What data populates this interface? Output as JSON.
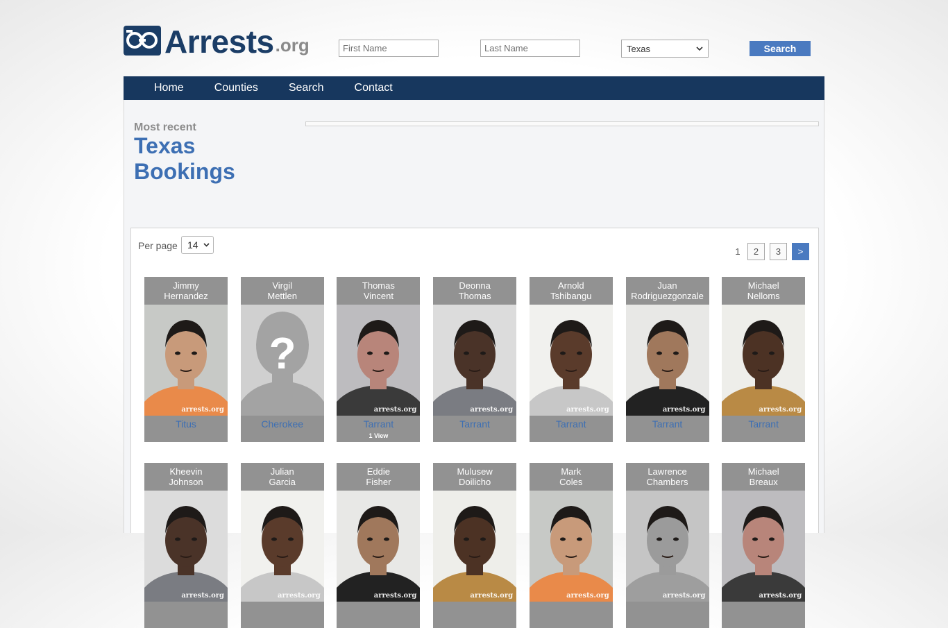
{
  "header": {
    "logo_word": "Arrests",
    "logo_ext": ".org",
    "first_name_placeholder": "First Name",
    "last_name_placeholder": "Last Name",
    "state_selected": "Texas",
    "search_label": "Search"
  },
  "nav": {
    "items": [
      {
        "label": "Home"
      },
      {
        "label": "Counties"
      },
      {
        "label": "Search"
      },
      {
        "label": "Contact"
      }
    ]
  },
  "main": {
    "subtitle": "Most recent",
    "title_line1": "Texas",
    "title_line2": "Bookings"
  },
  "listing": {
    "per_page_label": "Per page",
    "per_page_value": "14",
    "pagination": [
      "1",
      "2",
      "3",
      ">"
    ],
    "watermark": "arrests.org",
    "row1": [
      {
        "first": "Jimmy",
        "last": "Hernandez",
        "county": "Titus",
        "views": "",
        "photo": "mugshot"
      },
      {
        "first": "Virgil",
        "last": "Mettlen",
        "county": "Cherokee",
        "views": "",
        "photo": "placeholder"
      },
      {
        "first": "Thomas",
        "last": "Vincent",
        "county": "Tarrant",
        "views": "1 View",
        "photo": "mugshot"
      },
      {
        "first": "Deonna",
        "last": "Thomas",
        "county": "Tarrant",
        "views": "",
        "photo": "mugshot"
      },
      {
        "first": "Arnold",
        "last": "Tshibangu",
        "county": "Tarrant",
        "views": "",
        "photo": "mugshot"
      },
      {
        "first": "Juan",
        "last": "Rodriguezgonzale",
        "county": "Tarrant",
        "views": "",
        "photo": "mugshot"
      },
      {
        "first": "Michael",
        "last": "Nelloms",
        "county": "Tarrant",
        "views": "",
        "photo": "mugshot"
      }
    ],
    "row2": [
      {
        "first": "Kheevin",
        "last": "Johnson"
      },
      {
        "first": "Julian",
        "last": "Garcia"
      },
      {
        "first": "Eddie",
        "last": "Fisher"
      },
      {
        "first": "Mulusew",
        "last": "Doilicho"
      },
      {
        "first": "Mark",
        "last": "Coles"
      },
      {
        "first": "Lawrence",
        "last": "Chambers"
      },
      {
        "first": "Michael",
        "last": "Breaux"
      }
    ]
  },
  "colors": {
    "brand_navy": "#17375e",
    "link_blue": "#3d6fb3",
    "button_blue": "#4a7ac0",
    "card_gray": "#929292"
  }
}
